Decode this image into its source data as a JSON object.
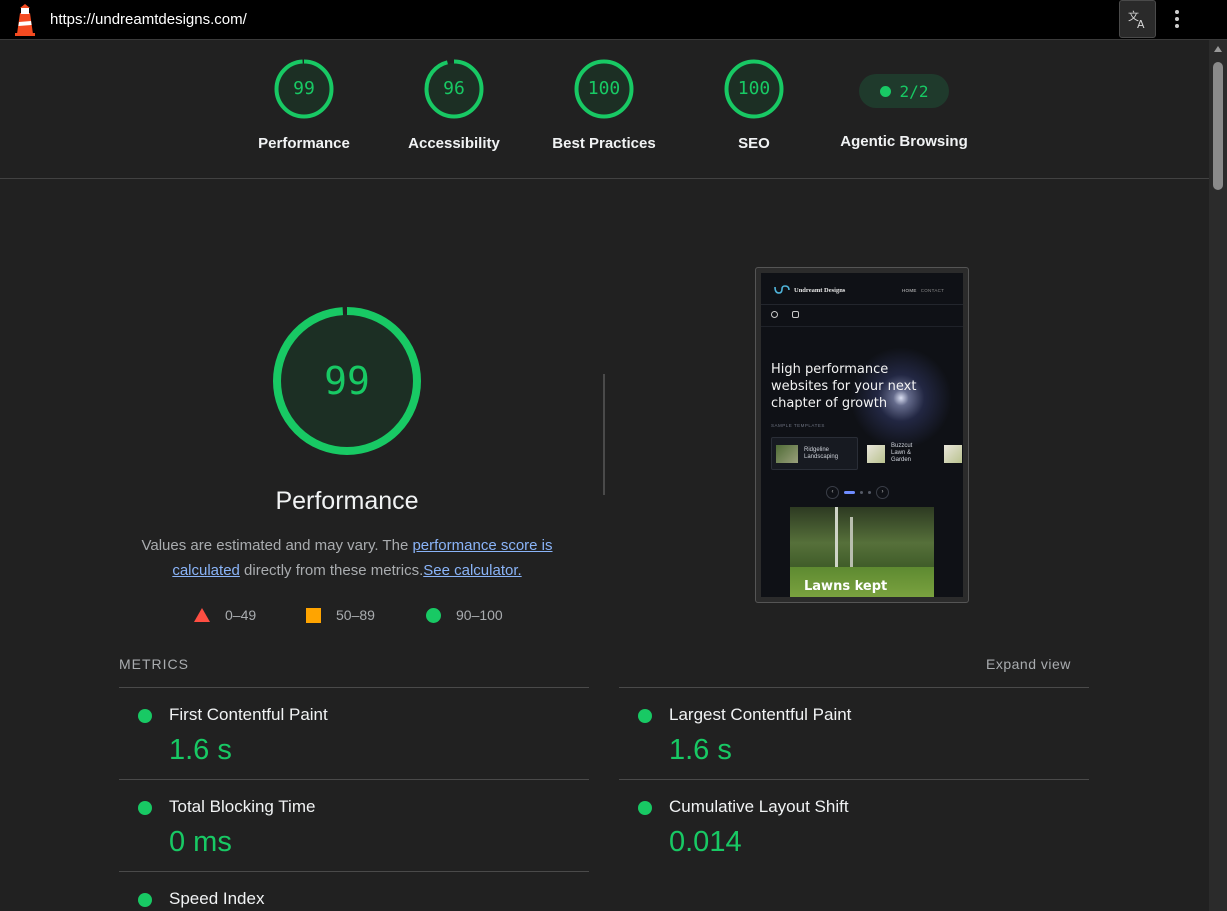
{
  "browser": {
    "url": "https://undreamtdesigns.com/",
    "translate_icon": "translate-icon",
    "more_icon": "more-vertical-icon"
  },
  "categories": [
    {
      "label": "Performance",
      "score": "99",
      "fraction": 0.99
    },
    {
      "label": "Accessibility",
      "score": "96",
      "fraction": 0.96
    },
    {
      "label": "Best Practices",
      "score": "100",
      "fraction": 1.0
    },
    {
      "label": "SEO",
      "score": "100",
      "fraction": 1.0
    }
  ],
  "agentic": {
    "label": "Agentic Browsing",
    "value": "2/2"
  },
  "performance": {
    "score": "99",
    "fraction": 0.99,
    "title": "Performance",
    "desc_1": "Values are estimated and may vary. The ",
    "desc_link_1": "performance score is calculated",
    "desc_2": " directly from these metrics.",
    "desc_link_2": "See calculator."
  },
  "legend": {
    "fail": "0–49",
    "average": "50–89",
    "pass": "90–100"
  },
  "thumbnail": {
    "brand": "Undreamt Designs",
    "nav_home": "HOME",
    "nav_contact": "CONTACT",
    "hero": "High performance websites for your next chapter of growth",
    "sample_label": "SAMPLE TEMPLATES",
    "card_1": "Ridgeline Landscaping",
    "card_2": "Buzzcut Lawn & Garden",
    "photo_text": "Lawns kept"
  },
  "metrics": {
    "header": "METRICS",
    "expand": "Expand view",
    "items": [
      {
        "name": "First Contentful Paint",
        "value": "1.6 s"
      },
      {
        "name": "Largest Contentful Paint",
        "value": "1.6 s"
      },
      {
        "name": "Total Blocking Time",
        "value": "0 ms"
      },
      {
        "name": "Cumulative Layout Shift",
        "value": "0.014"
      },
      {
        "name": "Speed Index",
        "value": ""
      }
    ]
  },
  "colors": {
    "pass": "#18c964",
    "average": "#ffa400",
    "fail": "#ff4e42",
    "background": "#212121"
  }
}
